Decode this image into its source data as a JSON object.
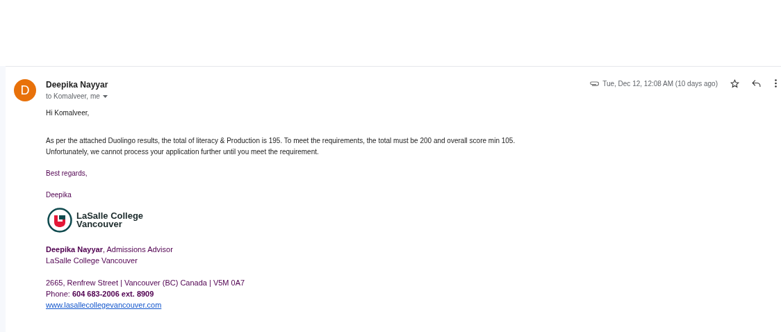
{
  "sender": {
    "initial": "D",
    "name": "Deepika Nayyar",
    "recipients": "to Komalveer, me"
  },
  "date": "Tue, Dec 12, 12:08 AM (10 days ago)",
  "has_attachment": true,
  "body": {
    "greeting": "Hi Komalveer,",
    "paragraph": [
      "As per the attached Duolingo results, the total of literacy & Production is 195. To meet the requirements, the total must be 200 and overall score min 105.",
      "Unfortunately, we cannot process your application further until you meet the requirement."
    ],
    "closing": "Best regards,",
    "signoff": "Deepika"
  },
  "signature": {
    "logo_text": [
      "LaSalle College",
      "Vancouver"
    ],
    "title_line": "**Deepika Nayyar**, Admissions Advisor",
    "school": "LaSalle College Vancouver",
    "address": "2665, Renfrew Street | Vancouver (BC) Canada | V5M 0A7",
    "phone": "Phone: **604 683-2006 ext. 8909**",
    "website": "www.lasallecollegevancouver.com"
  }
}
